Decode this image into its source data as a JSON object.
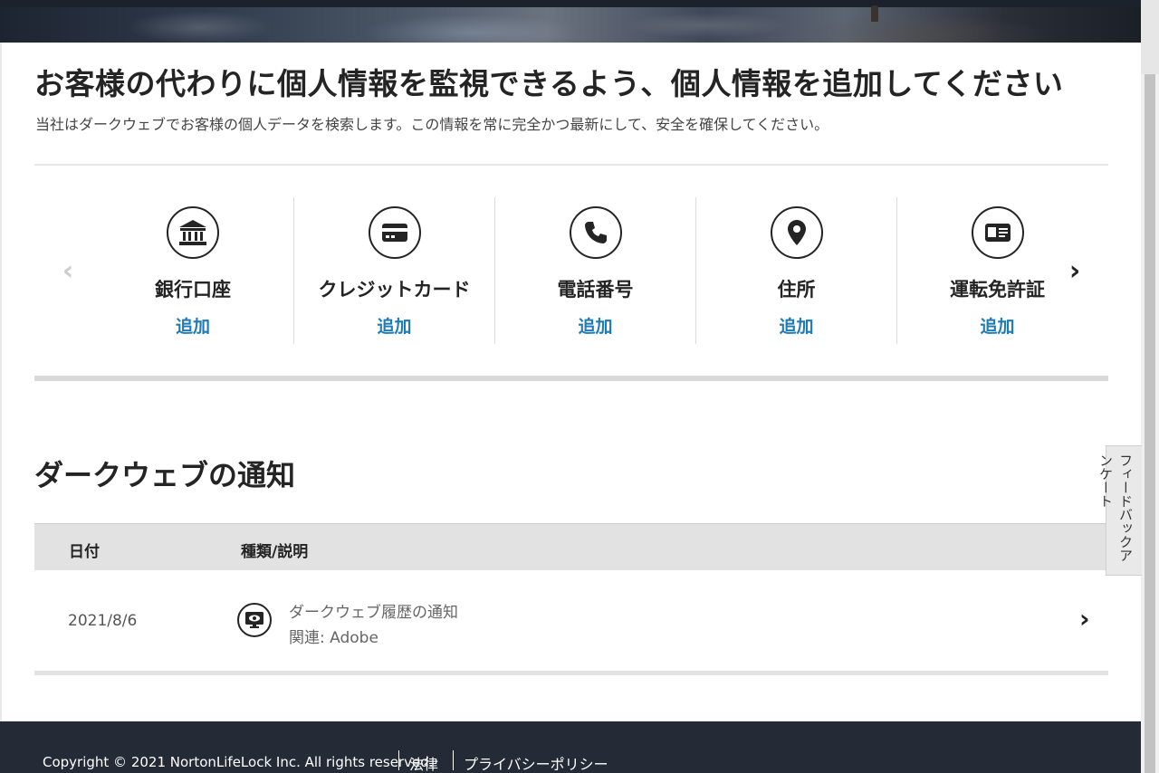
{
  "header": {
    "title": "お客様の代わりに個人情報を監視できるよう、個人情報を追加してください",
    "subtitle": "当社はダークウェブでお客様の個人データを検索します。この情報を常に完全かつ最新にして、安全を確保してください。"
  },
  "carousel": {
    "prev_icon": "chevron-left-icon",
    "next_icon": "chevron-right-icon",
    "items": [
      {
        "label": "銀行口座",
        "action": "追加",
        "icon": "bank-icon"
      },
      {
        "label": "クレジットカード",
        "action": "追加",
        "icon": "credit-card-icon"
      },
      {
        "label": "電話番号",
        "action": "追加",
        "icon": "phone-icon"
      },
      {
        "label": "住所",
        "action": "追加",
        "icon": "location-pin-icon"
      },
      {
        "label": "運転免許証",
        "action": "追加",
        "icon": "id-card-icon"
      }
    ]
  },
  "notifications": {
    "title": "ダークウェブの通知",
    "columns": {
      "date": "日付",
      "type": "種類/説明"
    },
    "rows": [
      {
        "date": "2021/8/6",
        "title": "ダークウェブ履歴の通知",
        "related": "関連: Adobe",
        "icon": "monitor-eye-icon"
      }
    ]
  },
  "feedback": {
    "label": "フィードバックアンケート"
  },
  "footer": {
    "copyright": "Copyright © 2021 NortonLifeLock Inc. All rights reserved.",
    "links": [
      "法律",
      "プライバシーポリシー"
    ]
  },
  "colors": {
    "accent_link": "#1e7bb5",
    "footer_bg": "#242b36",
    "text_dark": "#242424"
  }
}
